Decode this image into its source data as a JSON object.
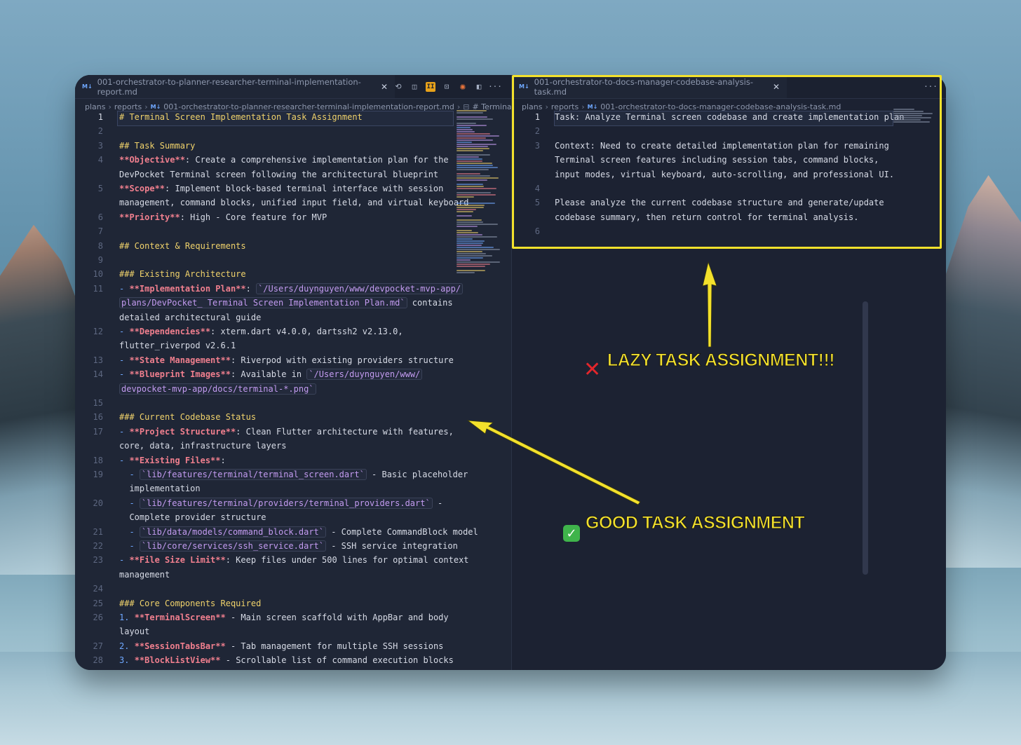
{
  "left_pane": {
    "tab": {
      "badge": "M↓",
      "title": "001-orchestrator-to-planner-researcher-terminal-implementation-report.md",
      "close": "✕"
    },
    "toolbar_icons": [
      "history-icon",
      "compare-icon",
      "orange-app-icon",
      "preview-icon",
      "claude-icon",
      "split-icon",
      "more-icon"
    ],
    "breadcrumb": [
      "plans",
      "reports",
      "001-orchestrator-to-planner-researcher-terminal-implementation-report.md",
      "# Terminal Scr"
    ],
    "lines": [
      {
        "n": "1",
        "segs": [
          [
            "h",
            "# Terminal Screen Implementation Task Assignment"
          ]
        ]
      },
      {
        "n": "2",
        "segs": []
      },
      {
        "n": "3",
        "segs": [
          [
            "h",
            "## Task Summary"
          ]
        ]
      },
      {
        "n": "4",
        "segs": [
          [
            "b",
            "**Objective**"
          ],
          [
            "t",
            ": Create a comprehensive implementation plan for the"
          ]
        ]
      },
      {
        "n": "",
        "segs": [
          [
            "t",
            "DevPocket Terminal screen following the architectural blueprint"
          ]
        ]
      },
      {
        "n": "5",
        "segs": [
          [
            "b",
            "**Scope**"
          ],
          [
            "t",
            ": Implement block-based terminal interface with session"
          ]
        ]
      },
      {
        "n": "",
        "segs": [
          [
            "t",
            "management, command blocks, unified input field, and virtual keyboard"
          ]
        ]
      },
      {
        "n": "6",
        "segs": [
          [
            "b",
            "**Priority**"
          ],
          [
            "t",
            ": High - Core feature for MVP"
          ]
        ]
      },
      {
        "n": "7",
        "segs": []
      },
      {
        "n": "8",
        "segs": [
          [
            "h",
            "## Context & Requirements"
          ]
        ]
      },
      {
        "n": "9",
        "segs": []
      },
      {
        "n": "10",
        "segs": [
          [
            "h",
            "### Existing Architecture"
          ]
        ]
      },
      {
        "n": "11",
        "segs": [
          [
            "d",
            "- "
          ],
          [
            "b",
            "**Implementation Plan**"
          ],
          [
            "t",
            ": "
          ],
          [
            "c",
            "`/Users/duynguyen/www/devpocket-mvp-app/"
          ]
        ]
      },
      {
        "n": "",
        "segs": [
          [
            "c",
            "plans/DevPocket_ Terminal Screen Implementation Plan.md`"
          ],
          [
            "t",
            " contains"
          ]
        ]
      },
      {
        "n": "",
        "segs": [
          [
            "t",
            "detailed architectural guide"
          ]
        ]
      },
      {
        "n": "12",
        "segs": [
          [
            "d",
            "- "
          ],
          [
            "b",
            "**Dependencies**"
          ],
          [
            "t",
            ": xterm.dart v4.0.0, dartssh2 v2.13.0,"
          ]
        ]
      },
      {
        "n": "",
        "segs": [
          [
            "t",
            "flutter_riverpod v2.6.1"
          ]
        ]
      },
      {
        "n": "13",
        "segs": [
          [
            "d",
            "- "
          ],
          [
            "b",
            "**State Management**"
          ],
          [
            "t",
            ": Riverpod with existing providers structure"
          ]
        ]
      },
      {
        "n": "14",
        "segs": [
          [
            "d",
            "- "
          ],
          [
            "b",
            "**Blueprint Images**"
          ],
          [
            "t",
            ": Available in "
          ],
          [
            "c",
            "`/Users/duynguyen/www/"
          ]
        ]
      },
      {
        "n": "",
        "segs": [
          [
            "c",
            "devpocket-mvp-app/docs/terminal-*.png`"
          ]
        ]
      },
      {
        "n": "15",
        "segs": []
      },
      {
        "n": "16",
        "segs": [
          [
            "h",
            "### Current Codebase Status"
          ]
        ]
      },
      {
        "n": "17",
        "segs": [
          [
            "d",
            "- "
          ],
          [
            "b",
            "**Project Structure**"
          ],
          [
            "t",
            ": Clean Flutter architecture with features,"
          ]
        ]
      },
      {
        "n": "",
        "segs": [
          [
            "t",
            "core, data, infrastructure layers"
          ]
        ]
      },
      {
        "n": "18",
        "segs": [
          [
            "d",
            "- "
          ],
          [
            "b",
            "**Existing Files**"
          ],
          [
            "t",
            ":"
          ]
        ]
      },
      {
        "n": "19",
        "segs": [
          [
            "t",
            "  "
          ],
          [
            "d",
            "- "
          ],
          [
            "c",
            "`lib/features/terminal/terminal_screen.dart`"
          ],
          [
            "t",
            " - Basic placeholder"
          ]
        ]
      },
      {
        "n": "",
        "segs": [
          [
            "t",
            "  implementation"
          ]
        ]
      },
      {
        "n": "20",
        "segs": [
          [
            "t",
            "  "
          ],
          [
            "d",
            "- "
          ],
          [
            "c",
            "`lib/features/terminal/providers/terminal_providers.dart`"
          ],
          [
            "t",
            " -"
          ]
        ]
      },
      {
        "n": "",
        "segs": [
          [
            "t",
            "  Complete provider structure"
          ]
        ]
      },
      {
        "n": "21",
        "segs": [
          [
            "t",
            "  "
          ],
          [
            "d",
            "- "
          ],
          [
            "c",
            "`lib/data/models/command_block.dart`"
          ],
          [
            "t",
            " - Complete CommandBlock model"
          ]
        ]
      },
      {
        "n": "22",
        "segs": [
          [
            "t",
            "  "
          ],
          [
            "d",
            "- "
          ],
          [
            "c",
            "`lib/core/services/ssh_service.dart`"
          ],
          [
            "t",
            " - SSH service integration"
          ]
        ]
      },
      {
        "n": "23",
        "segs": [
          [
            "d",
            "- "
          ],
          [
            "b",
            "**File Size Limit**"
          ],
          [
            "t",
            ": Keep files under 500 lines for optimal context"
          ]
        ]
      },
      {
        "n": "",
        "segs": [
          [
            "t",
            "management"
          ]
        ]
      },
      {
        "n": "24",
        "segs": []
      },
      {
        "n": "25",
        "segs": [
          [
            "h",
            "### Core Components Required"
          ]
        ]
      },
      {
        "n": "26",
        "segs": [
          [
            "d",
            "1. "
          ],
          [
            "b",
            "**TerminalScreen**"
          ],
          [
            "t",
            " - Main screen scaffold with AppBar and body"
          ]
        ]
      },
      {
        "n": "",
        "segs": [
          [
            "t",
            "layout"
          ]
        ]
      },
      {
        "n": "27",
        "segs": [
          [
            "d",
            "2. "
          ],
          [
            "b",
            "**SessionTabsBar**"
          ],
          [
            "t",
            " - Tab management for multiple SSH sessions"
          ]
        ]
      },
      {
        "n": "28",
        "segs": [
          [
            "d",
            "3. "
          ],
          [
            "b",
            "**BlockListView**"
          ],
          [
            "t",
            " - Scrollable list of command execution blocks"
          ]
        ]
      }
    ]
  },
  "right_pane": {
    "tab": {
      "badge": "M↓",
      "title": "001-orchestrator-to-docs-manager-codebase-analysis-task.md",
      "close": "✕"
    },
    "more": "···",
    "breadcrumb": [
      "plans",
      "reports",
      "001-orchestrator-to-docs-manager-codebase-analysis-task.md"
    ],
    "lines": [
      {
        "n": "1",
        "segs": [
          [
            "t",
            "Task: Analyze Terminal screen codebase and create implementation plan"
          ]
        ]
      },
      {
        "n": "2",
        "segs": []
      },
      {
        "n": "3",
        "segs": [
          [
            "t",
            "Context: Need to create detailed implementation plan for remaining"
          ]
        ]
      },
      {
        "n": "",
        "segs": [
          [
            "t",
            "Terminal screen features including session tabs, command blocks,"
          ]
        ]
      },
      {
        "n": "",
        "segs": [
          [
            "t",
            "input modes, virtual keyboard, auto-scrolling, and professional UI."
          ]
        ]
      },
      {
        "n": "4",
        "segs": []
      },
      {
        "n": "5",
        "segs": [
          [
            "t",
            "Please analyze the current codebase structure and generate/update"
          ]
        ]
      },
      {
        "n": "",
        "segs": [
          [
            "t",
            "codebase summary, then return control for terminal analysis."
          ]
        ]
      },
      {
        "n": "6",
        "segs": []
      }
    ]
  },
  "annotations": {
    "lazy": "LAZY TASK ASSIGNMENT!!!",
    "good": "GOOD TASK ASSIGNMENT",
    "cross": "✕",
    "check": "✓",
    "highlight_color": "#f3e12c"
  }
}
